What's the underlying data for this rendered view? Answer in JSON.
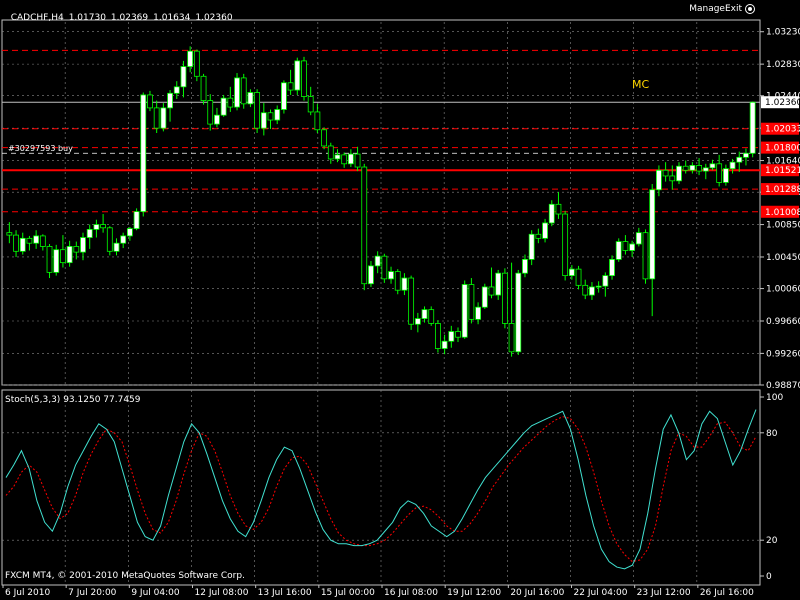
{
  "header": {
    "symbol": "CADCHF,H4",
    "open": "1.01730",
    "high": "1.02369",
    "low": "1.01634",
    "close": "1.02360"
  },
  "expert_name": "ManageExit",
  "mc_label": "MC",
  "order_label": "#30297593 buy",
  "copyright": "FXCM MT4, © 2001-2010 MetaQuotes Software Corp.",
  "stoch": {
    "title": "Stoch(5,3,3)",
    "main": "93.1250",
    "signal": "77.7459"
  },
  "colors": {
    "bull_candle": "#ffffff",
    "bear_candle": "#000000",
    "wick": "#00ff00",
    "grid": "#888888",
    "red_line": "#ff0000",
    "stoch_main": "#40e0d0",
    "stoch_signal": "#ff0000"
  },
  "price_axis": {
    "labels": [
      "1.03230",
      "1.02830",
      "1.02440",
      "1.02040",
      "1.01640",
      "1.01250",
      "1.00850",
      "1.00450",
      "1.00060",
      "0.99660",
      "0.99260",
      "0.98870"
    ],
    "values": [
      1.0323,
      1.0283,
      1.0244,
      1.0204,
      1.0164,
      1.0125,
      1.0085,
      1.0045,
      1.0006,
      0.9966,
      0.9926,
      0.9887
    ],
    "current": "1.02360",
    "current_value": 1.0236
  },
  "price_tags": [
    {
      "label": "1.02033",
      "value": 1.02033
    },
    {
      "label": "1.01800",
      "value": 1.018
    },
    {
      "label": "1.01521",
      "value": 1.01521
    },
    {
      "label": "1.01288",
      "value": 1.01288
    },
    {
      "label": "1.01008",
      "value": 1.01008
    }
  ],
  "red_dashed_levels": [
    1.03,
    1.02033,
    1.018,
    1.01288,
    1.01008
  ],
  "order_level": 1.01521,
  "time_axis": [
    "6 Jul 2010",
    "7 Jul 20:00",
    "9 Jul 04:00",
    "12 Jul 08:00",
    "13 Jul 16:00",
    "15 Jul 00:00",
    "16 Jul 08:00",
    "19 Jul 12:00",
    "20 Jul 16:00",
    "22 Jul 04:00",
    "23 Jul 12:00",
    "26 Jul 16:00"
  ],
  "stoch_axis": [
    {
      "label": "100",
      "value": 100
    },
    {
      "label": "80",
      "value": 80
    },
    {
      "label": "20",
      "value": 20
    },
    {
      "label": "0",
      "value": 0
    }
  ],
  "chart_data": {
    "type": "candlestick",
    "ylim": [
      0.9887,
      1.0323
    ],
    "candles": [
      [
        1.0075,
        1.0088,
        1.0062,
        1.0072
      ],
      [
        1.0072,
        1.0078,
        1.0045,
        1.0052
      ],
      [
        1.0052,
        1.0075,
        1.0048,
        1.0068
      ],
      [
        1.0068,
        1.0071,
        1.0053,
        1.0062
      ],
      [
        1.0062,
        1.0078,
        1.0055,
        1.0071
      ],
      [
        1.0071,
        1.0073,
        1.0053,
        1.0058
      ],
      [
        1.0058,
        1.0061,
        1.0019,
        1.0026
      ],
      [
        1.0026,
        1.006,
        1.0022,
        1.0054
      ],
      [
        1.0054,
        1.0072,
        1.0032,
        1.0038
      ],
      [
        1.0038,
        1.0065,
        1.0033,
        1.0058
      ],
      [
        1.0058,
        1.0064,
        1.0042,
        1.0051
      ],
      [
        1.0051,
        1.0075,
        1.0041,
        1.0069
      ],
      [
        1.0069,
        1.0085,
        1.0055,
        1.0079
      ],
      [
        1.0079,
        1.0091,
        1.0069,
        1.0085
      ],
      [
        1.0085,
        1.0098,
        1.0075,
        1.0081
      ],
      [
        1.0081,
        1.0083,
        1.0047,
        1.0052
      ],
      [
        1.0052,
        1.0068,
        1.0047,
        1.0062
      ],
      [
        1.0062,
        1.0075,
        1.0056,
        1.0071
      ],
      [
        1.0071,
        1.0082,
        1.0065,
        1.008
      ],
      [
        1.008,
        1.0105,
        1.0078,
        1.0101
      ],
      [
        1.0101,
        1.0248,
        1.0095,
        1.0245
      ],
      [
        1.0245,
        1.025,
        1.0225,
        1.0229
      ],
      [
        1.0229,
        1.0238,
        1.0198,
        1.0204
      ],
      [
        1.0204,
        1.0235,
        1.02,
        1.0229
      ],
      [
        1.0229,
        1.0251,
        1.0212,
        1.0247
      ],
      [
        1.0247,
        1.0262,
        1.024,
        1.0255
      ],
      [
        1.0255,
        1.0287,
        1.0242,
        1.028
      ],
      [
        1.028,
        1.0305,
        1.0273,
        1.0299
      ],
      [
        1.0299,
        1.0301,
        1.0262,
        1.0268
      ],
      [
        1.0268,
        1.0271,
        1.0233,
        1.0238
      ],
      [
        1.0238,
        1.0246,
        1.0201,
        1.0209
      ],
      [
        1.0209,
        1.0229,
        1.0205,
        1.022
      ],
      [
        1.022,
        1.0245,
        1.0218,
        1.0241
      ],
      [
        1.0241,
        1.0255,
        1.0224,
        1.023
      ],
      [
        1.023,
        1.0272,
        1.0226,
        1.0266
      ],
      [
        1.0266,
        1.0271,
        1.0228,
        1.0234
      ],
      [
        1.0234,
        1.0252,
        1.023,
        1.0248
      ],
      [
        1.0248,
        1.0252,
        1.0198,
        1.0204
      ],
      [
        1.0204,
        1.0235,
        1.0195,
        1.0223
      ],
      [
        1.0223,
        1.0227,
        1.0203,
        1.0214
      ],
      [
        1.0214,
        1.0232,
        1.0209,
        1.0227
      ],
      [
        1.0227,
        1.0263,
        1.0222,
        1.026
      ],
      [
        1.026,
        1.0276,
        1.0245,
        1.0251
      ],
      [
        1.0251,
        1.0291,
        1.0245,
        1.0287
      ],
      [
        1.0287,
        1.0292,
        1.0238,
        1.0243
      ],
      [
        1.0243,
        1.0255,
        1.022,
        1.0224
      ],
      [
        1.0224,
        1.0234,
        1.0198,
        1.0202
      ],
      [
        1.0202,
        1.0205,
        1.0178,
        1.0182
      ],
      [
        1.0182,
        1.0186,
        1.016,
        1.0166
      ],
      [
        1.0166,
        1.0178,
        1.0162,
        1.0171
      ],
      [
        1.0171,
        1.0174,
        1.0155,
        1.016
      ],
      [
        1.016,
        1.0178,
        1.0156,
        1.0172
      ],
      [
        1.0172,
        1.0181,
        1.0151,
        1.0156
      ],
      [
        1.0156,
        1.016,
        1.0004,
        1.0012
      ],
      [
        1.0012,
        1.004,
        1.0008,
        1.0034
      ],
      [
        1.0034,
        1.0052,
        1.0025,
        1.0046
      ],
      [
        1.0046,
        1.0049,
        1.0013,
        1.0018
      ],
      [
        1.0018,
        1.0033,
        1.0012,
        1.0027
      ],
      [
        1.0027,
        1.003,
        0.9999,
        1.0004
      ],
      [
        1.0004,
        1.0025,
        0.9998,
        1.0019
      ],
      [
        1.0019,
        1.0022,
        0.9955,
        0.9962
      ],
      [
        0.9962,
        0.9976,
        0.9952,
        0.9969
      ],
      [
        0.9969,
        0.9984,
        0.9964,
        0.998
      ],
      [
        0.998,
        0.9984,
        0.996,
        0.9963
      ],
      [
        0.9963,
        0.9967,
        0.9927,
        0.9932
      ],
      [
        0.9932,
        0.9949,
        0.9925,
        0.9941
      ],
      [
        0.9941,
        0.996,
        0.9933,
        0.9953
      ],
      [
        0.9953,
        0.9958,
        0.994,
        0.9946
      ],
      [
        0.9946,
        1.0016,
        0.9944,
        1.0011
      ],
      [
        1.0011,
        1.0019,
        0.9963,
        0.9968
      ],
      [
        0.9968,
        0.9989,
        0.9962,
        0.9983
      ],
      [
        0.9983,
        1.0012,
        0.9981,
        1.0008
      ],
      [
        1.0008,
        1.0032,
        0.9994,
        0.9998
      ],
      [
        0.9998,
        1.0029,
        0.9992,
        1.0025
      ],
      [
        1.0025,
        1.0031,
        0.9957,
        0.9963
      ],
      [
        0.9963,
        1.0038,
        0.9922,
        0.9928
      ],
      [
        0.9928,
        1.0029,
        0.9924,
        1.0025
      ],
      [
        1.0025,
        1.0048,
        1.002,
        1.0042
      ],
      [
        1.0042,
        1.0078,
        1.0035,
        1.0073
      ],
      [
        1.0073,
        1.008,
        1.0062,
        1.0068
      ],
      [
        1.0068,
        1.0092,
        1.0063,
        1.0087
      ],
      [
        1.0087,
        1.0115,
        1.0083,
        1.011
      ],
      [
        1.011,
        1.0125,
        1.0092,
        1.0098
      ],
      [
        1.0098,
        1.0102,
        1.0016,
        1.0022
      ],
      [
        1.0022,
        1.0035,
        1.0017,
        1.003
      ],
      [
        1.003,
        1.0034,
        1.0005,
        1.001
      ],
      [
        1.001,
        1.0017,
        0.9993,
        0.9998
      ],
      [
        0.9998,
        1.0014,
        0.9992,
        1.0008
      ],
      [
        1.0008,
        1.0015,
        1.0001,
        1.0009
      ],
      [
        1.0009,
        1.0026,
        0.9996,
        1.0022
      ],
      [
        1.0022,
        1.0047,
        1.0017,
        1.0042
      ],
      [
        1.0042,
        1.0068,
        1.0039,
        1.0064
      ],
      [
        1.0064,
        1.0072,
        1.0048,
        1.0053
      ],
      [
        1.0053,
        1.0065,
        1.0045,
        1.0061
      ],
      [
        1.0061,
        1.0081,
        1.0058,
        1.0075
      ],
      [
        1.0075,
        1.0079,
        1.0012,
        1.0018
      ],
      [
        1.0018,
        1.0135,
        0.9972,
        1.0128
      ],
      [
        1.0128,
        1.0158,
        1.012,
        1.0152
      ],
      [
        1.0152,
        1.0162,
        1.0138,
        1.0145
      ],
      [
        1.0145,
        1.0158,
        1.0128,
        1.0139
      ],
      [
        1.0139,
        1.0162,
        1.0135,
        1.0157
      ],
      [
        1.0157,
        1.0164,
        1.0148,
        1.0152
      ],
      [
        1.0152,
        1.0162,
        1.0148,
        1.0158
      ],
      [
        1.0158,
        1.0167,
        1.0146,
        1.0151
      ],
      [
        1.0151,
        1.016,
        1.0141,
        1.0155
      ],
      [
        1.0155,
        1.0165,
        1.0152,
        1.016
      ],
      [
        1.016,
        1.0171,
        1.0132,
        1.0137
      ],
      [
        1.0137,
        1.0159,
        1.0133,
        1.0154
      ],
      [
        1.0154,
        1.0166,
        1.0148,
        1.0162
      ],
      [
        1.0162,
        1.0175,
        1.015,
        1.0168
      ],
      [
        1.0168,
        1.0179,
        1.0158,
        1.0173
      ],
      [
        1.0173,
        1.0237,
        1.0168,
        1.0236
      ]
    ],
    "stochastic": {
      "name": "Stoch(5,3,3)",
      "main": [
        55,
        62,
        70,
        60,
        42,
        30,
        25,
        35,
        50,
        62,
        70,
        78,
        85,
        82,
        75,
        60,
        45,
        30,
        22,
        20,
        28,
        45,
        60,
        75,
        85,
        80,
        68,
        55,
        42,
        32,
        25,
        22,
        30,
        42,
        55,
        65,
        72,
        70,
        60,
        48,
        36,
        26,
        20,
        18,
        18,
        17,
        17,
        18,
        20,
        25,
        30,
        38,
        42,
        40,
        35,
        28,
        25,
        22,
        25,
        32,
        40,
        48,
        55,
        60,
        65,
        70,
        75,
        80,
        84,
        86,
        88,
        90,
        92,
        82,
        65,
        45,
        28,
        15,
        8,
        5,
        4,
        6,
        15,
        35,
        60,
        82,
        90,
        80,
        65,
        70,
        85,
        92,
        88,
        75,
        62,
        70,
        82,
        93
      ],
      "signal": [
        45,
        50,
        58,
        62,
        58,
        48,
        38,
        32,
        35,
        45,
        58,
        68,
        76,
        82,
        80,
        75,
        62,
        48,
        35,
        26,
        24,
        30,
        42,
        57,
        70,
        80,
        78,
        70,
        58,
        45,
        35,
        28,
        26,
        30,
        38,
        50,
        60,
        66,
        67,
        62,
        52,
        42,
        32,
        24,
        20,
        18,
        17,
        17,
        18,
        20,
        24,
        29,
        34,
        38,
        39,
        37,
        33,
        28,
        25,
        25,
        29,
        35,
        42,
        50,
        56,
        62,
        67,
        72,
        76,
        80,
        84,
        87,
        89,
        88,
        82,
        72,
        58,
        42,
        28,
        18,
        12,
        8,
        9,
        15,
        28,
        50,
        70,
        80,
        78,
        72,
        72,
        78,
        85,
        86,
        80,
        72,
        70,
        78
      ]
    }
  }
}
